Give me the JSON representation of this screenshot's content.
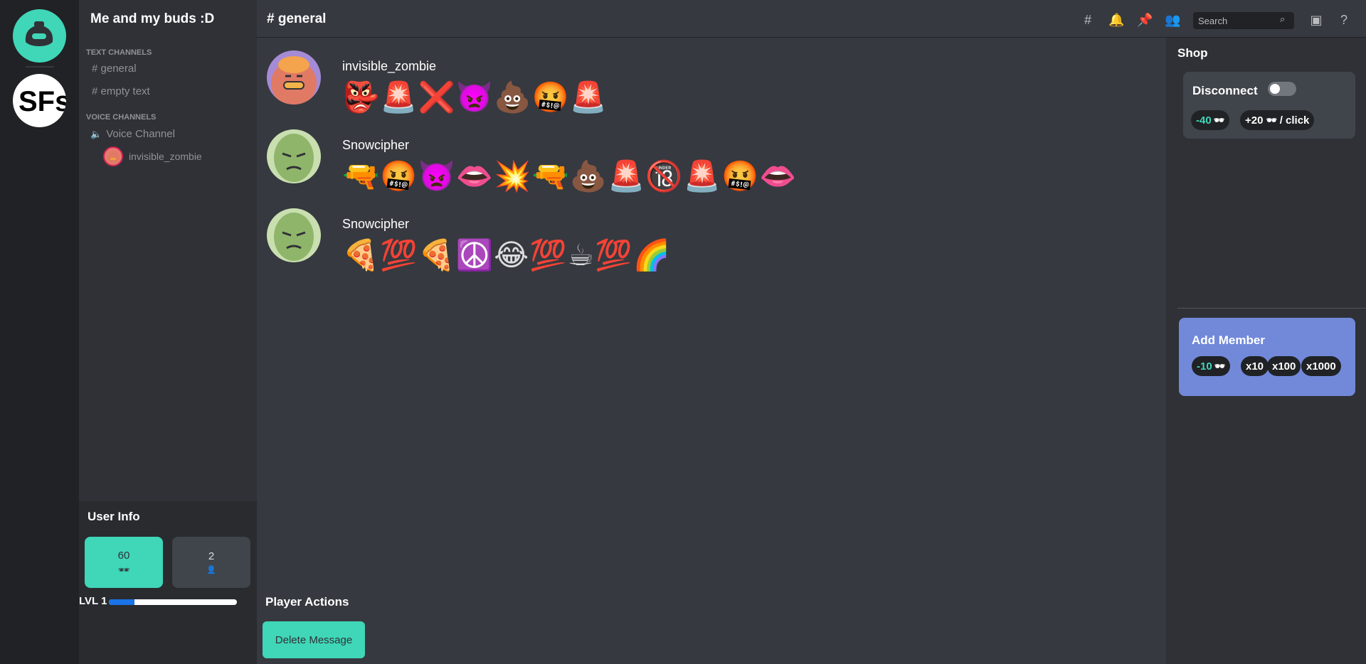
{
  "server": {
    "name": "Me and my buds :D"
  },
  "channels": {
    "text_category": "TEXT CHANNELS",
    "text": [
      "# general",
      "# empty text"
    ],
    "voice_category": "VOICE CHANNELS",
    "voice": [
      "Voice Channel"
    ],
    "voice_users": [
      "invisible_zombie"
    ]
  },
  "user_info": {
    "title": "User Info",
    "coins": "60",
    "coins_icon": "🕶",
    "members": "2",
    "members_icon": "👤",
    "level": "LVL 1",
    "level_progress": 0.2
  },
  "header": {
    "channel": "# general",
    "search_placeholder": "Search",
    "icons": [
      "threads-icon",
      "bell-icon",
      "pin-icon",
      "members-icon",
      "inbox-icon",
      "help-icon"
    ]
  },
  "messages": [
    {
      "author": "invisible_zombie",
      "emojis": "👺🚨❌👿💩🤬🚨"
    },
    {
      "author": "Snowcipher",
      "emojis": "🔫🤬👿👄💥🔫💩🚨🔞🚨🤬👄"
    },
    {
      "author": "Snowcipher",
      "emojis": "🍕💯🍕☮️😂💯☕💯🌈"
    }
  ],
  "player_actions": {
    "title": "Player Actions",
    "delete_label": "Delete Message"
  },
  "shop": {
    "title": "Shop",
    "disconnect": {
      "label": "Disconnect",
      "cost": "-40",
      "cost_icon": "🕶",
      "gain_prefix": "+20",
      "gain_icon": "🕶",
      "gain_suffix": "/ click"
    },
    "add_member": {
      "label": "Add Member",
      "cost": "-10",
      "cost_icon": "🕶",
      "multipliers": [
        "x10",
        "x100",
        "x1000"
      ]
    }
  },
  "colors": {
    "accent": "#40d6b8",
    "blurple": "#7289da",
    "bg": "#36393f",
    "sidebar": "#2f3136",
    "rail": "#202225"
  }
}
